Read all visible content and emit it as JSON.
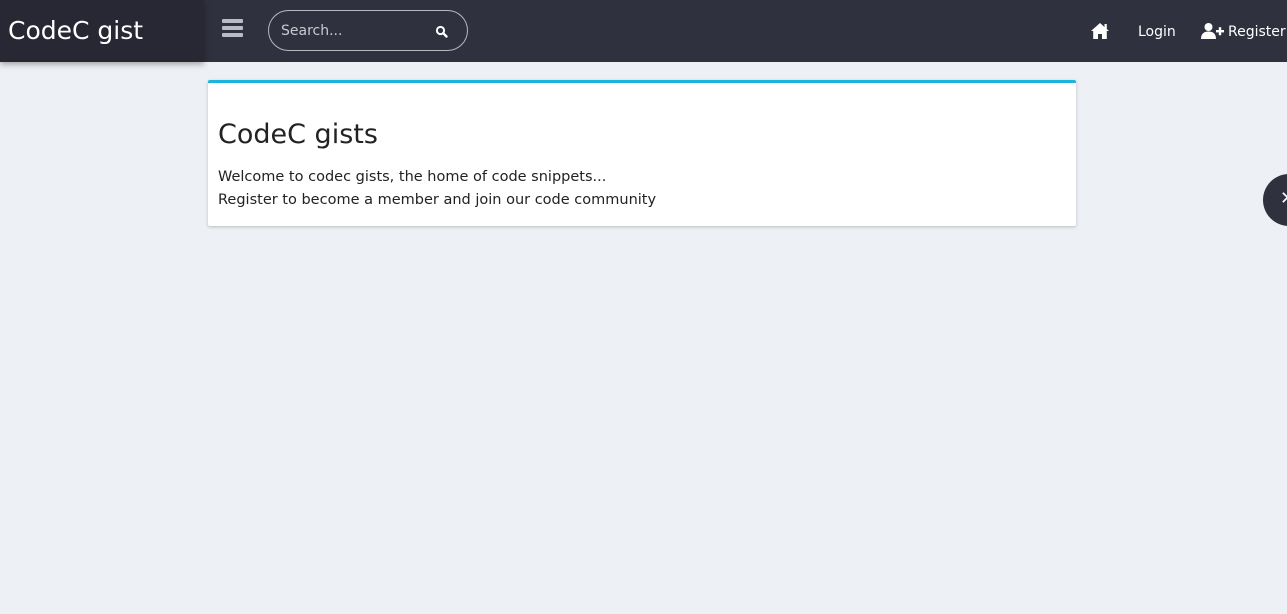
{
  "header": {
    "brand": "CodeC gist",
    "menu_icon": "hamburger-icon",
    "search": {
      "placeholder": "Search...",
      "value": "",
      "icon": "search-icon"
    },
    "nav": {
      "home_icon": "home-icon",
      "login_label": "Login",
      "register_icon": "user-plus-icon",
      "register_label": "Register"
    }
  },
  "main": {
    "card": {
      "title": "CodeC gists",
      "line1": "Welcome to codec gists, the home of code snippets...",
      "line2": "Register to become a member and join our code community"
    }
  },
  "side_tab": {
    "icon": "close-icon",
    "glyph": "✕"
  },
  "colors": {
    "header_bg": "#2f313e",
    "brand_bg": "#272834",
    "page_bg": "#edf0f5",
    "card_accent": "#1ab4dd",
    "text": "#222222"
  }
}
